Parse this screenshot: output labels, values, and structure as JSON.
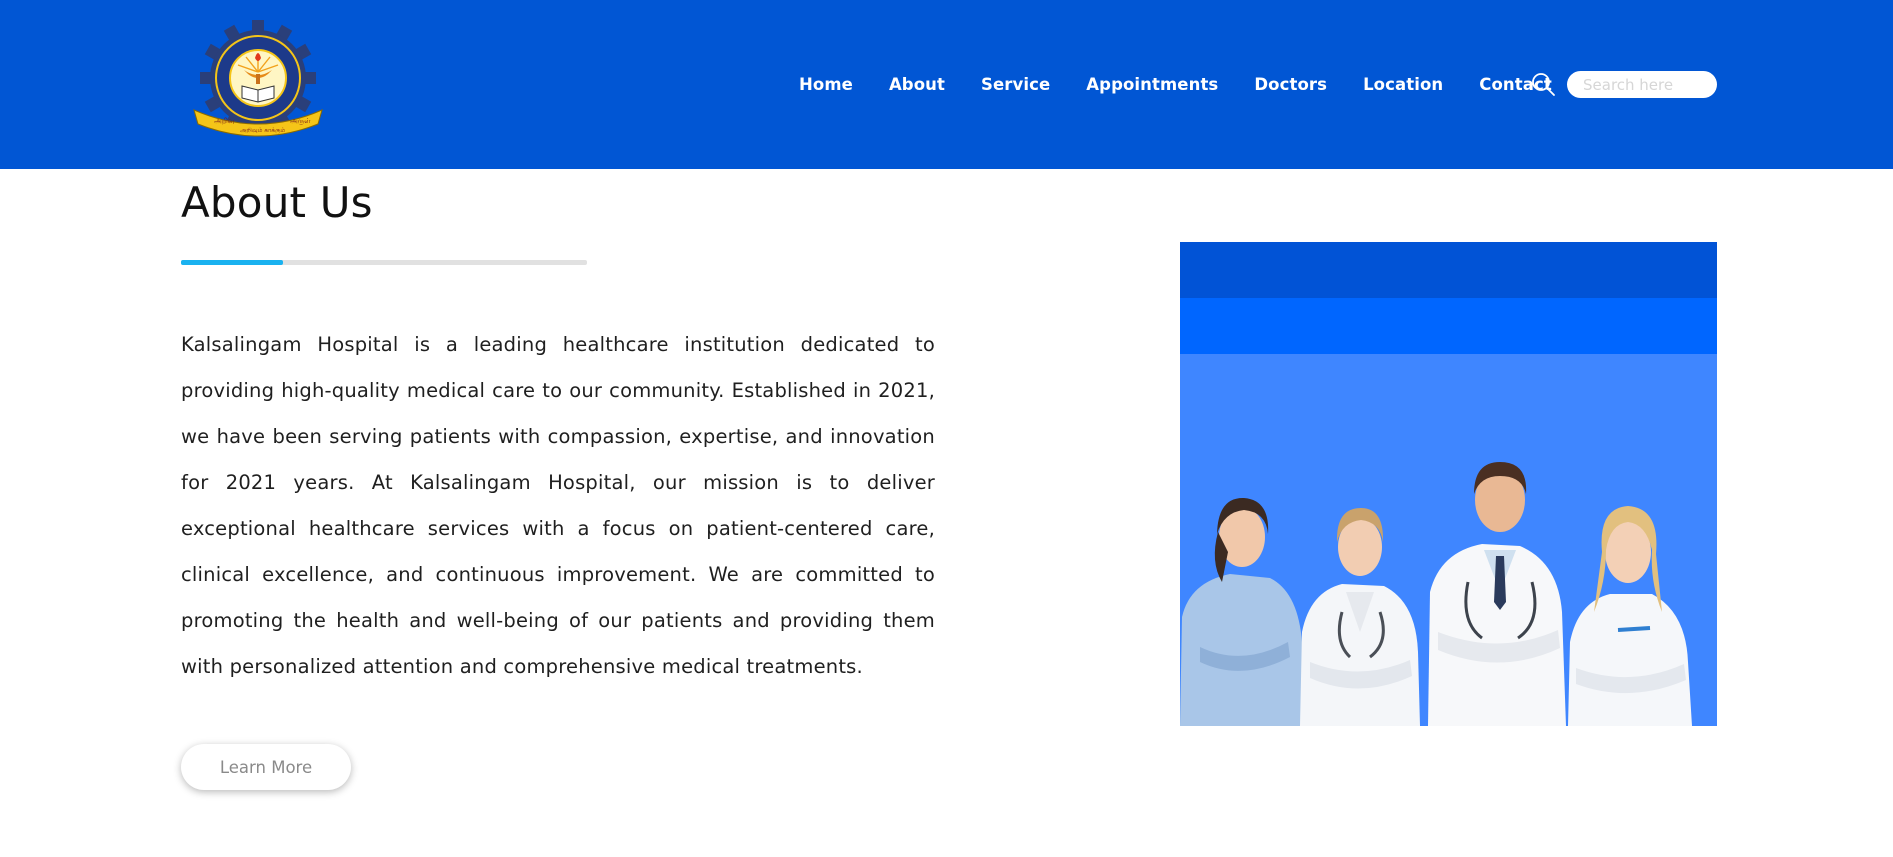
{
  "header": {
    "logo": {
      "name": "kalasalingam-academy-logo",
      "arc_text": "KALASALINGAM ACADEMY OF RESEARCH AND EDUCATION",
      "banner_text": "அறிவு அறிவும் காக்கும் அருள்"
    },
    "nav": [
      {
        "label": "Home"
      },
      {
        "label": "About"
      },
      {
        "label": "Service"
      },
      {
        "label": "Appointments"
      },
      {
        "label": "Doctors"
      },
      {
        "label": "Location"
      },
      {
        "label": "Contact"
      }
    ],
    "search": {
      "icon": "search-icon",
      "placeholder": "Search here",
      "value": ""
    }
  },
  "about": {
    "title": "About Us",
    "body": "Kalsalingam Hospital is a leading healthcare institution dedicated to providing high-quality medical care to our community. Established in 2021, we have been serving patients with compassion, expertise, and innovation for 2021 years. At Kalsalingam Hospital, our mission is to deliver exceptional healthcare services with a focus on patient-centered care, clinical excellence, and continuous improvement. We are committed to promoting the health and well-being of our patients and providing them with personalized attention and comprehensive medical treatments.",
    "button_label": "Learn More"
  },
  "colors": {
    "header_bg": "#0156d4",
    "accent_underline": "#1ab2f0",
    "image_band_dark": "#0153d6",
    "image_band_mid": "#0066ff",
    "image_band_light": "#3f86ff"
  }
}
